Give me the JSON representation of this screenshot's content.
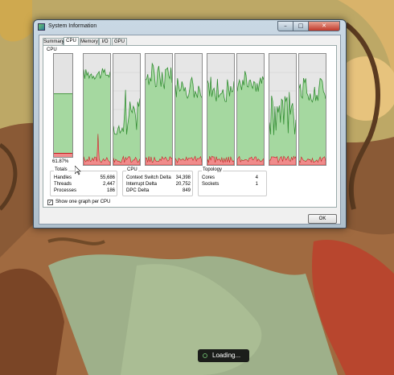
{
  "window": {
    "title": "System Information",
    "tabs": [
      {
        "label": "Summary",
        "active": false
      },
      {
        "label": "CPU",
        "active": true
      },
      {
        "label": "Memory",
        "active": false
      },
      {
        "label": "I/O",
        "active": false
      },
      {
        "label": "GPU",
        "active": false
      }
    ]
  },
  "cpu_panel": {
    "meter_label": "CPU",
    "usage_percent": "61.87%",
    "usage_fraction": 0.6187,
    "kernel_fraction": 0.04,
    "graph_count": 8
  },
  "totals": {
    "title": "Totals",
    "rows": [
      {
        "label": "Handles",
        "value": "55,686"
      },
      {
        "label": "Threads",
        "value": "2,447"
      },
      {
        "label": "Processes",
        "value": "186"
      }
    ]
  },
  "cpu_stats": {
    "title": "CPU",
    "rows": [
      {
        "label": "Context Switch Delta",
        "value": "34,398"
      },
      {
        "label": "Interrupt Delta",
        "value": "20,752"
      },
      {
        "label": "DPC Delta",
        "value": "849"
      }
    ]
  },
  "topology": {
    "title": "Topology",
    "rows": [
      {
        "label": "Cores",
        "value": "4"
      },
      {
        "label": "Sockets",
        "value": "1"
      }
    ]
  },
  "options": {
    "show_one_graph_label": "Show one graph per CPU",
    "show_one_graph_checked": true
  },
  "buttons": {
    "ok": "OK"
  },
  "overlay": {
    "loading": "Loading..."
  },
  "colors": {
    "graph_fill": "#a5d8a0",
    "graph_line": "#2e8b2e",
    "kernel_fill": "#f08b8b",
    "kernel_line": "#c02020",
    "graph_bg": "#e6e6e6"
  }
}
